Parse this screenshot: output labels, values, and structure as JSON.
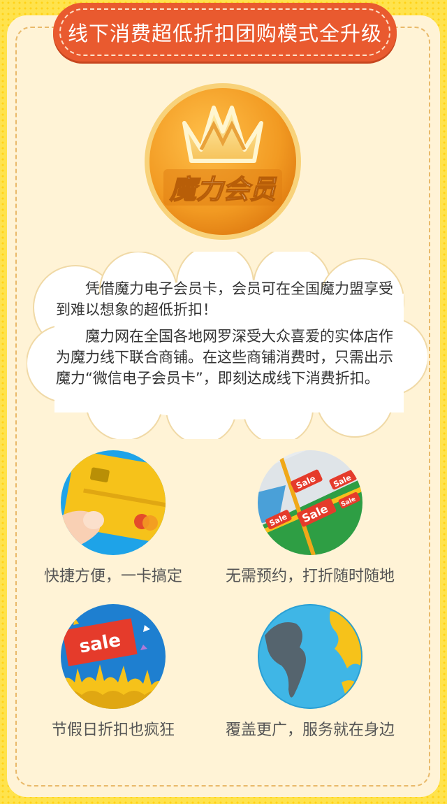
{
  "banner": {
    "title": "线下消费超低折扣团购模式全升级"
  },
  "badge": {
    "text": "魔力会员",
    "icon": "crown-icon"
  },
  "intro": {
    "paragraph1": "凭借魔力电子会员卡，会员可在全国魔力盟享受到难以想象的超低折扣！",
    "paragraph2": "魔力网在全国各地网罗深受大众喜爱的实体店作为魔力线下联合商铺。在这些商铺消费时，只需出示魔力“微信电子会员卡”，即刻达成线下消费折扣。"
  },
  "features": [
    {
      "icon": "credit-card-icon",
      "label": "快捷方便，一卡搞定"
    },
    {
      "icon": "sale-map-icon",
      "label": "无需预约，打折随时随地"
    },
    {
      "icon": "sale-crowd-icon",
      "label": "节假日折扣也疯狂",
      "sign": "sale"
    },
    {
      "icon": "globe-icon",
      "label": "覆盖更广，服务就在身边"
    }
  ],
  "map_tags": [
    "Sale",
    "Sale",
    "Sale",
    "Sale",
    "Sale"
  ],
  "colors": {
    "background": "#ffe34d",
    "card": "#fff3d6",
    "banner": "#e95a2f",
    "badge": "#f39a22"
  }
}
